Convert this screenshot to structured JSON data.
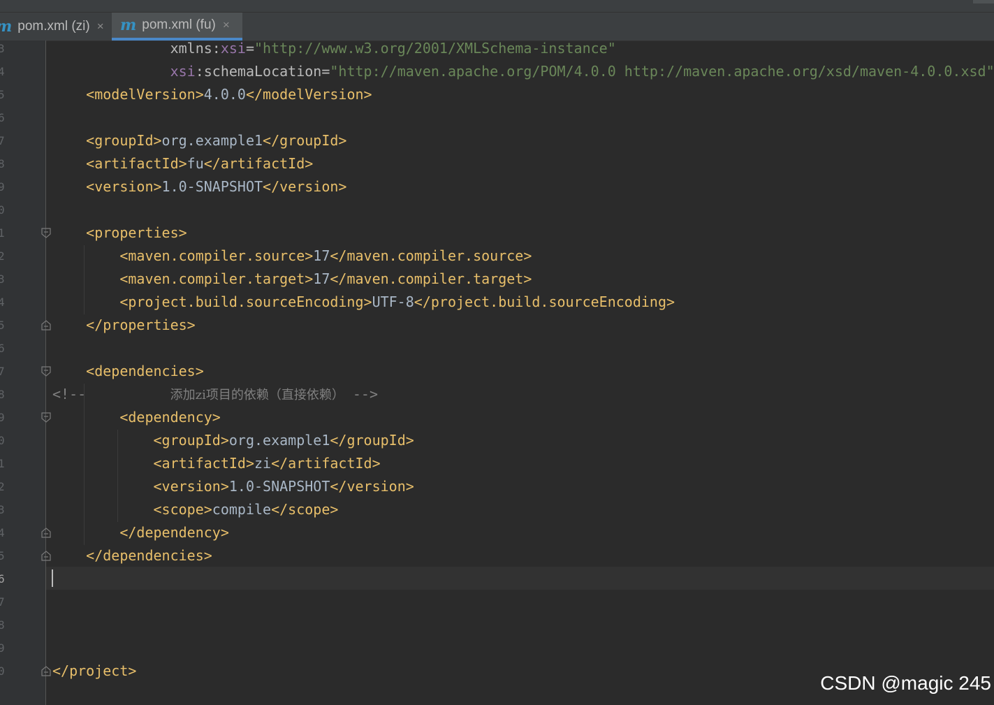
{
  "tabs": [
    {
      "icon": "m",
      "label": "pom.xml (zi)",
      "close": "×"
    },
    {
      "icon": "m",
      "label": "pom.xml (fu)",
      "close": "×"
    }
  ],
  "gutter": {
    "line_numbers": [
      "3",
      "4",
      "5",
      "6",
      "7",
      "8",
      "9",
      "0",
      "1",
      "2",
      "3",
      "4",
      "5",
      "6",
      "7",
      "8",
      "9",
      "0",
      "1",
      "2",
      "3",
      "4",
      "5",
      "6",
      "7",
      "8",
      "9",
      "0"
    ]
  },
  "code": {
    "l1": {
      "attr": "xmlns:",
      "ns": "xsi",
      "eq": "=",
      "value": "\"http://www.w3.org/2001/XMLSchema-instance\""
    },
    "l2": {
      "ns": "xsi",
      "attr": ":schemaLocation",
      "eq": "=",
      "value": "\"http://maven.apache.org/POM/4.0.0 http://maven.apache.org/xsd/maven-4.0.0.xsd\"",
      "close": ">"
    },
    "l3": {
      "open": "<modelVersion>",
      "text": "4.0.0",
      "close": "</modelVersion>"
    },
    "l5": {
      "open": "<groupId>",
      "text": "org.example1",
      "close": "</groupId>"
    },
    "l6": {
      "open": "<artifactId>",
      "text": "fu",
      "close": "</artifactId>"
    },
    "l7": {
      "open": "<version>",
      "text": "1.0-SNAPSHOT",
      "close": "</version>"
    },
    "l9": {
      "open": "<properties>"
    },
    "l10": {
      "open": "<maven.compiler.source>",
      "text": "17",
      "close": "</maven.compiler.source>"
    },
    "l11": {
      "open": "<maven.compiler.target>",
      "text": "17",
      "close": "</maven.compiler.target>"
    },
    "l12": {
      "open": "<project.build.sourceEncoding>",
      "text": "UTF-8",
      "close": "</project.build.sourceEncoding>"
    },
    "l13": {
      "close": "</properties>"
    },
    "l15": {
      "open": "<dependencies>"
    },
    "l16": {
      "comment_start": "<!--",
      "comment_text": "添加zi项目的依赖（直接依赖）",
      "comment_end": "-->"
    },
    "l17": {
      "open": "<dependency>"
    },
    "l18": {
      "open": "<groupId>",
      "text": "org.example1",
      "close": "</groupId>"
    },
    "l19": {
      "open": "<artifactId>",
      "text": "zi",
      "close": "</artifactId>"
    },
    "l20": {
      "open": "<version>",
      "text": "1.0-SNAPSHOT",
      "close": "</version>"
    },
    "l21": {
      "open": "<scope>",
      "text": "compile",
      "close": "</scope>"
    },
    "l22": {
      "close": "</dependency>"
    },
    "l23": {
      "close": "</dependencies>"
    },
    "l28": {
      "close": "</project>"
    }
  },
  "watermark": "CSDN @magic 245"
}
